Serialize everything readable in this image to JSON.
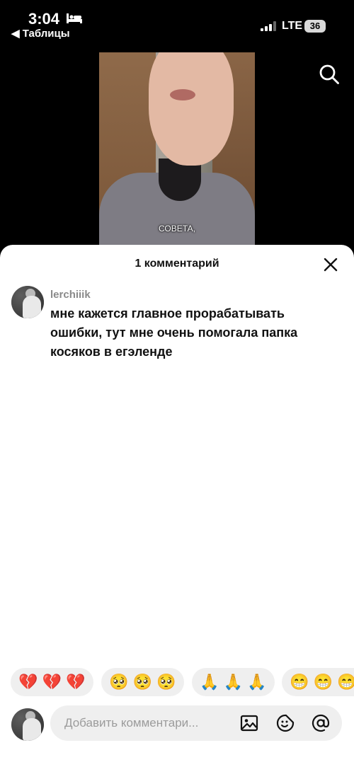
{
  "status_bar": {
    "time": "3:04",
    "back_label": "◀ Таблицы",
    "network": "LTE",
    "battery": "36"
  },
  "video": {
    "caption": "СОВЕТА,"
  },
  "comments_sheet": {
    "title": "1 комментарий",
    "comments": [
      {
        "username": "lerchiiik",
        "text": "мне кажется главное прорабатывать ошибки, тут мне очень помогала папка косяков в егэленде"
      }
    ]
  },
  "emoji_bar": {
    "chips": [
      "💔 💔 💔",
      "🥺 🥺 🥺",
      "🙏 🙏 🙏",
      "😁 😁 😁"
    ]
  },
  "comment_input": {
    "placeholder": "Добавить комментари..."
  },
  "icons": [
    "bed-icon",
    "signal-icon",
    "search-icon",
    "close-icon",
    "image-icon",
    "sticker-icon",
    "mention-icon"
  ]
}
